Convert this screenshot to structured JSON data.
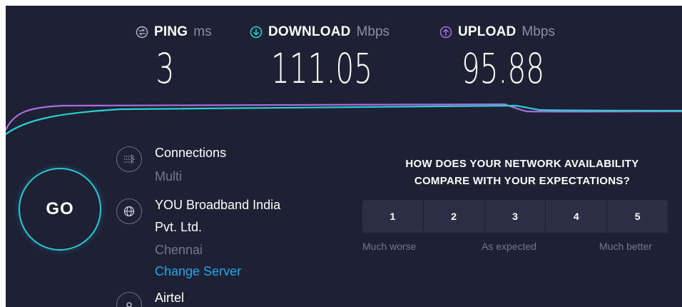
{
  "metrics": {
    "ping": {
      "label": "PING",
      "unit": "ms",
      "value": "3"
    },
    "download": {
      "label": "DOWNLOAD",
      "unit": "Mbps",
      "value": "111.05"
    },
    "upload": {
      "label": "UPLOAD",
      "unit": "Mbps",
      "value": "95.88"
    }
  },
  "go_button": {
    "label": "GO"
  },
  "server": {
    "connections_label": "Connections",
    "connections_value": "Multi",
    "isp_name_line1": "YOU Broadband India",
    "isp_name_line2": "Pvt. Ltd.",
    "location": "Chennai",
    "change_server": "Change Server",
    "host": "Airtel"
  },
  "survey": {
    "question_line1": "HOW DOES YOUR NETWORK AVAILABILITY",
    "question_line2": "COMPARE WITH YOUR EXPECTATIONS?",
    "ratings": [
      "1",
      "2",
      "3",
      "4",
      "5"
    ],
    "label_low": "Much worse",
    "label_mid": "As expected",
    "label_high": "Much better"
  },
  "colors": {
    "background": "#1e2034",
    "download_accent": "#2bd1d1",
    "upload_accent": "#a86ee0",
    "link": "#1da8e8"
  },
  "icons": [
    "ping-icon",
    "download-icon",
    "upload-icon",
    "connections-icon",
    "globe-icon",
    "server-icon"
  ]
}
